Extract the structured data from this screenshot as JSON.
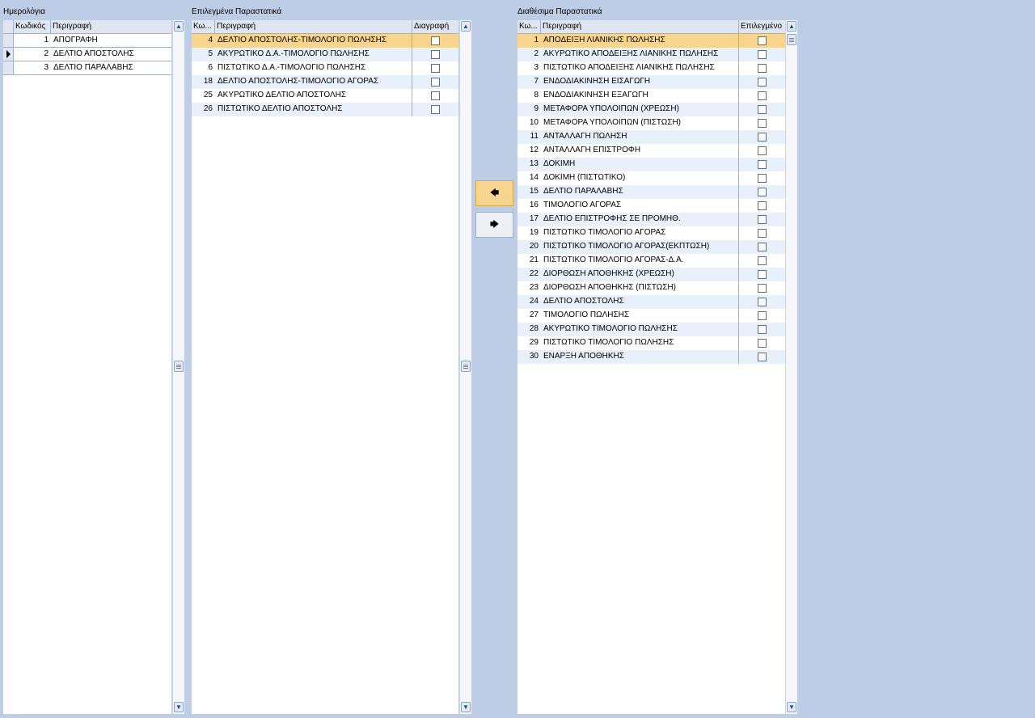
{
  "journals": {
    "label": "Ημερολόγια",
    "headers": {
      "code": "Κωδικός",
      "desc": "Περιγραφή"
    },
    "rows": [
      {
        "code": "1",
        "desc": "ΑΠΟΓΡΑΦΗ"
      },
      {
        "code": "2",
        "desc": "ΔΕΛΤΙΟ ΑΠΟΣΤΟΛΗΣ"
      },
      {
        "code": "3",
        "desc": "ΔΕΛΤΙΟ ΠΑΡΑΛΑΒΗΣ"
      }
    ]
  },
  "selected": {
    "label": "Επιλεγμένα Παραστατικά",
    "headers": {
      "code": "Κω...",
      "desc": "Περιγραφή",
      "delete": "Διαγραφή"
    },
    "rows": [
      {
        "code": "4",
        "desc": "ΔΕΛΤΙΟ ΑΠΟΣΤΟΛΗΣ-ΤΙΜΟΛΟΓΙΟ ΠΩΛΗΣΗΣ"
      },
      {
        "code": "5",
        "desc": "ΑΚΥΡΩΤΙΚΟ Δ.Α.-ΤΙΜΟΛΟΓΙΟ ΠΩΛΗΣΗΣ"
      },
      {
        "code": "6",
        "desc": "ΠΙΣΤΩΤΙΚΟ Δ.Α.-ΤΙΜΟΛΟΓΙΟ ΠΩΛΗΣΗΣ"
      },
      {
        "code": "18",
        "desc": "ΔΕΛΤΙΟ ΑΠΟΣΤΟΛΗΣ-ΤΙΜΟΛΟΓΙΟ ΑΓΟΡΑΣ"
      },
      {
        "code": "25",
        "desc": "ΑΚΥΡΩΤΙΚΟ ΔΕΛΤΙΟ ΑΠΟΣΤΟΛΗΣ"
      },
      {
        "code": "26",
        "desc": "ΠΙΣΤΩΤΙΚΟ ΔΕΛΤΙΟ ΑΠΟΣΤΟΛΗΣ"
      }
    ]
  },
  "available": {
    "label": "Διαθέσιμα Παραστατικά",
    "headers": {
      "code": "Κω...",
      "desc": "Περιγραφή",
      "chosen": "Επιλεγμένο"
    },
    "rows": [
      {
        "code": "1",
        "desc": "ΑΠΟΔΕΙΞΗ ΛΙΑΝΙΚΗΣ ΠΩΛΗΣΗΣ"
      },
      {
        "code": "2",
        "desc": "ΑΚΥΡΩΤΙΚΟ ΑΠΟΔΕΙΞΗΣ ΛΙΑΝΙΚΗΣ ΠΩΛΗΣΗΣ"
      },
      {
        "code": "3",
        "desc": "ΠΙΣΤΩΤΙΚΟ ΑΠΟΔΕΙΞΗΣ ΛΙΑΝΙΚΗΣ ΠΩΛΗΣΗΣ"
      },
      {
        "code": "7",
        "desc": "ΕΝΔΟΔΙΑΚΙΝΗΣΗ ΕΙΣΑΓΩΓΗ"
      },
      {
        "code": "8",
        "desc": "ΕΝΔΟΔΙΑΚΙΝΗΣΗ ΕΞΑΓΩΓΗ"
      },
      {
        "code": "9",
        "desc": "ΜΕΤΑΦΟΡΑ ΥΠΟΛΟΙΠΩΝ (ΧΡΕΩΣΗ)"
      },
      {
        "code": "10",
        "desc": "ΜΕΤΑΦΟΡΑ ΥΠΟΛΟΙΠΩΝ (ΠΙΣΤΩΣΗ)"
      },
      {
        "code": "11",
        "desc": "ΑΝΤΑΛΛΑΓΗ ΠΩΛΗΣΗ"
      },
      {
        "code": "12",
        "desc": "ΑΝΤΑΛΛΑΓΗ ΕΠΙΣΤΡΟΦΗ"
      },
      {
        "code": "13",
        "desc": "ΔΟΚΙΜΗ"
      },
      {
        "code": "14",
        "desc": "ΔΟΚΙΜΗ (ΠΙΣΤΩΤΙΚΟ)"
      },
      {
        "code": "15",
        "desc": "ΔΕΛΤΙΟ ΠΑΡΑΛΑΒΗΣ"
      },
      {
        "code": "16",
        "desc": "ΤΙΜΟΛΟΓΙΟ ΑΓΟΡΑΣ"
      },
      {
        "code": "17",
        "desc": "ΔΕΛΤΙΟ ΕΠΙΣΤΡΟΦΗΣ ΣΕ ΠΡΟΜΗΘ."
      },
      {
        "code": "19",
        "desc": "ΠΙΣΤΩΤΙΚΟ ΤΙΜΟΛΟΓΙΟ ΑΓΟΡΑΣ"
      },
      {
        "code": "20",
        "desc": "ΠΙΣΤΩΤΙΚΟ ΤΙΜΟΛΟΓΙΟ ΑΓΟΡΑΣ(ΕΚΠΤΩΣΗ)"
      },
      {
        "code": "21",
        "desc": "ΠΙΣΤΩΤΙΚΟ ΤΙΜΟΛΟΓΙΟ ΑΓΟΡΑΣ-Δ.Α."
      },
      {
        "code": "22",
        "desc": "ΔΙΟΡΘΩΣΗ ΑΠΟΘΗΚΗΣ (ΧΡΕΩΣΗ)"
      },
      {
        "code": "23",
        "desc": "ΔΙΟΡΘΩΣΗ ΑΠΟΘΗΚΗΣ (ΠΙΣΤΩΣΗ)"
      },
      {
        "code": "24",
        "desc": "ΔΕΛΤΙΟ ΑΠΟΣΤΟΛΗΣ"
      },
      {
        "code": "27",
        "desc": "ΤΙΜΟΛΟΓΙΟ ΠΩΛΗΣΗΣ"
      },
      {
        "code": "28",
        "desc": "ΑΚΥΡΩΤΙΚΟ ΤΙΜΟΛΟΓΙΟ ΠΩΛΗΣΗΣ"
      },
      {
        "code": "29",
        "desc": "ΠΙΣΤΩΤΙΚΟ ΤΙΜΟΛΟΓΙΟ ΠΩΛΗΣΗΣ"
      },
      {
        "code": "30",
        "desc": "ΕΝΑΡΞΗ ΑΠΟΘΗΚΗΣ"
      }
    ]
  },
  "buttons": {
    "add_icon": "arrow-left-icon",
    "add_glyph": "🡄",
    "remove_icon": "arrow-right-icon",
    "remove_glyph": "🡆"
  },
  "colors": {
    "selected_row": "#f8d58e",
    "alt_row": "#e8f0fb",
    "background": "#bccde5"
  }
}
